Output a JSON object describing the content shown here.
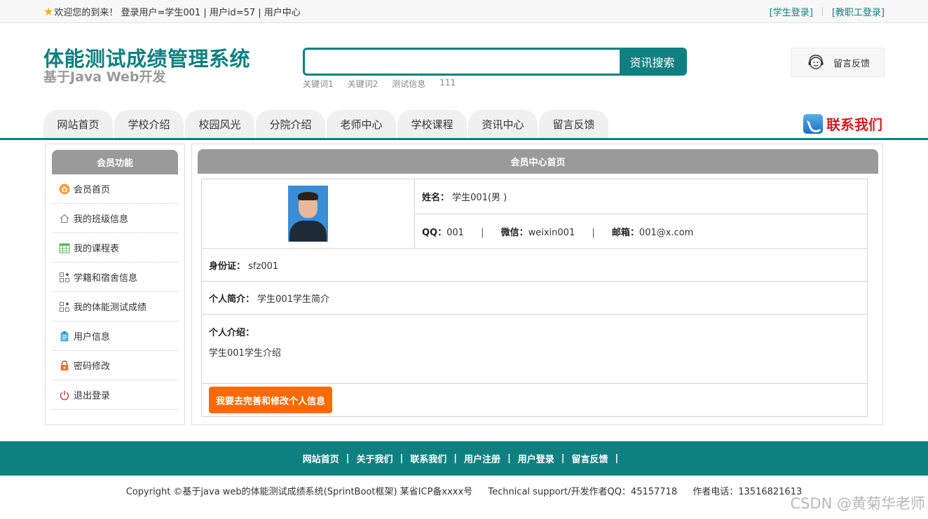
{
  "topbar": {
    "welcome": "欢迎您的到来！ 登录用户=学生001 | 用户id=57 | 用户中心",
    "student_login": "[学生登录]",
    "staff_login": "[教职工登录]"
  },
  "header": {
    "title": "体能测试成绩管理系统",
    "subtitle": "基于Java Web开发",
    "search": {
      "value": "",
      "button": "资讯搜索"
    },
    "keywords": [
      "关键词1",
      "关键词2",
      "测试信息",
      "111"
    ],
    "feedback_label": "留言反馈"
  },
  "nav": {
    "items": [
      "网站首页",
      "学校介绍",
      "校园风光",
      "分院介绍",
      "老师中心",
      "学校课程",
      "资讯中心",
      "留言反馈"
    ],
    "contact": "联系我们"
  },
  "sidebar": {
    "title": "会员功能",
    "items": [
      {
        "label": "会员首页",
        "icon": "home-circle-icon"
      },
      {
        "label": "我的班级信息",
        "icon": "house-icon"
      },
      {
        "label": "我的课程表",
        "icon": "calendar-icon"
      },
      {
        "label": "学籍和宿舍信息",
        "icon": "grid-icon"
      },
      {
        "label": "我的体能测试成绩",
        "icon": "grid-icon"
      },
      {
        "label": "用户信息",
        "icon": "clipboard-icon"
      },
      {
        "label": "密码修改",
        "icon": "lock-icon"
      },
      {
        "label": "退出登录",
        "icon": "power-icon"
      }
    ]
  },
  "main": {
    "title": "会员中心首页",
    "name_label": "姓名：",
    "name_value": "学生001(男 )",
    "qq_label": "QQ：",
    "qq_value": "001",
    "wechat_label": "微信：",
    "wechat_value": "weixin001",
    "email_label": "邮箱：",
    "email_value": "001@x.com",
    "idcard_label": "身份证：",
    "idcard_value": "sfz001",
    "brief_label": "个人简介：",
    "brief_value": "学生001学生简介",
    "intro_label": "个人介绍：",
    "intro_value": "学生001学生介绍",
    "edit_button": "我要去完善和修改个人信息"
  },
  "footer": {
    "links": [
      "网站首页",
      "关于我们",
      "联系我们",
      "用户注册",
      "用户登录",
      "留言反馈"
    ],
    "copyright": "Copyright ©基于java web的体能测试成绩系统(SprintBoot框架) 某省ICP备xxxx号",
    "support": "Technical support/开发作者QQ：45157718",
    "phone": "作者电话：13516821613"
  },
  "watermark": "CSDN @黄菊华老师",
  "colors": {
    "accent": "#0f8080",
    "button_orange": "#ff6a00",
    "header_gray": "#9a9a9a",
    "contact_red": "#d81e1e"
  }
}
